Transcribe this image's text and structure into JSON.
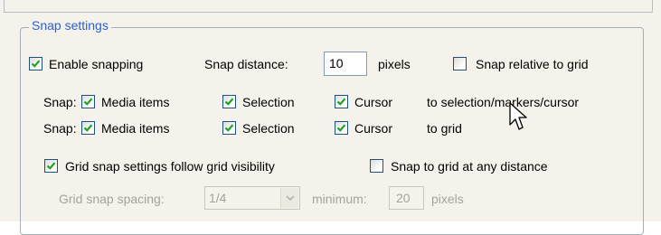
{
  "group": {
    "title": "Snap settings"
  },
  "row1": {
    "enable_snapping_label": "Enable snapping",
    "enable_snapping_checked": true,
    "snap_distance_label": "Snap distance:",
    "snap_distance_value": "10",
    "pixels_label": "pixels",
    "snap_relative_label": "Snap relative to grid",
    "snap_relative_checked": false
  },
  "row2": {
    "snap_label": "Snap:",
    "media_items_label": "Media items",
    "selection_label": "Selection",
    "cursor_label": "Cursor",
    "target_label": "to selection/markers/cursor"
  },
  "row3": {
    "snap_label": "Snap:",
    "media_items_label": "Media items",
    "selection_label": "Selection",
    "cursor_label": "Cursor",
    "target_label": "to grid"
  },
  "row4": {
    "grid_follow_label": "Grid snap settings follow grid visibility",
    "grid_follow_checked": true,
    "snap_any_distance_label": "Snap to grid at any distance",
    "snap_any_distance_checked": false
  },
  "row5": {
    "grid_spacing_label": "Grid snap spacing:",
    "grid_spacing_value": "1/4",
    "minimum_label": "minimum:",
    "minimum_value": "20",
    "pixels_label": "pixels"
  },
  "colors": {
    "group_title": "#2b5fd8",
    "check_mark": "#21a121",
    "disabled_text": "#a3a39e",
    "panel_background": "#f4f2ea"
  }
}
